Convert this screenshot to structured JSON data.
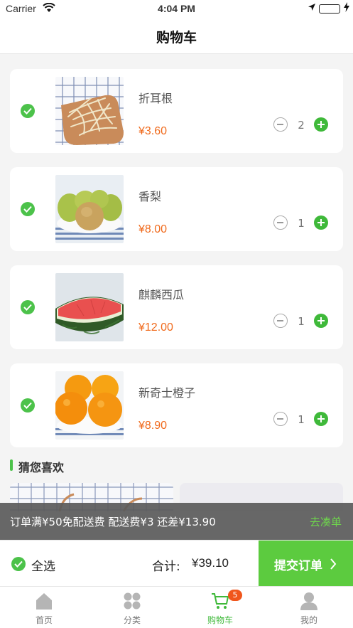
{
  "status_bar": {
    "carrier": "Carrier",
    "time": "4:04 PM"
  },
  "nav": {
    "title": "购物车"
  },
  "cart": {
    "items": [
      {
        "name": "折耳根",
        "price": "¥3.60",
        "quantity": "2",
        "checked": true,
        "image": "herb-root-image"
      },
      {
        "name": "香梨",
        "price": "¥8.00",
        "quantity": "1",
        "checked": true,
        "image": "pear-image"
      },
      {
        "name": "麒麟西瓜",
        "price": "¥12.00",
        "quantity": "1",
        "checked": true,
        "image": "watermelon-image"
      },
      {
        "name": "新奇士橙子",
        "price": "¥8.90",
        "quantity": "1",
        "checked": true,
        "image": "orange-image"
      }
    ]
  },
  "recommend": {
    "title": "猜您喜欢"
  },
  "delivery_banner": {
    "info": "订单满¥50免配送费 配送费¥3  还差¥13.90",
    "action": "去凑单"
  },
  "checkout": {
    "select_all_label": "全选",
    "total_label": "合计:",
    "total_value": "¥39.10",
    "submit_label": "提交订单"
  },
  "tabbar": {
    "tabs": [
      {
        "label": "首页",
        "icon": "home-icon"
      },
      {
        "label": "分类",
        "icon": "category-icon"
      },
      {
        "label": "购物车",
        "icon": "cart-icon",
        "badge": "5",
        "active": true
      },
      {
        "label": "我的",
        "icon": "profile-icon"
      }
    ]
  },
  "colors": {
    "accent_green": "#5ccb3f",
    "price_orange": "#f06a1c",
    "badge_red": "#f0561c"
  }
}
